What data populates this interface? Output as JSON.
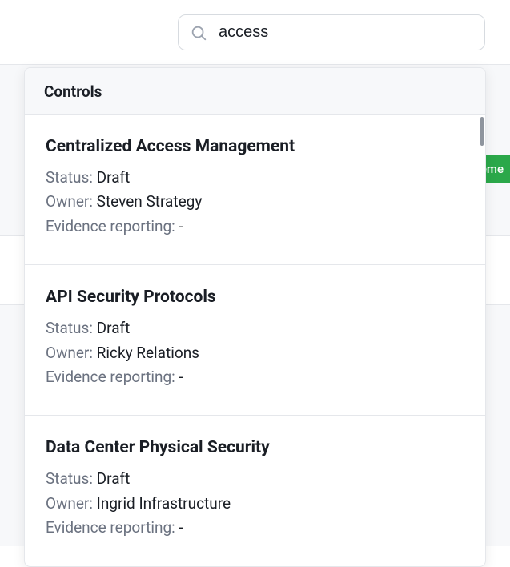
{
  "search": {
    "value": "access",
    "placeholder": "Search"
  },
  "badge_text": "eme",
  "dropdown": {
    "header": "Controls",
    "results": [
      {
        "title": "Centralized Access Management",
        "status_label": "Status: ",
        "status_value": "Draft",
        "owner_label": "Owner: ",
        "owner_value": "Steven Strategy",
        "evidence_label": "Evidence reporting: ",
        "evidence_value": " -"
      },
      {
        "title": "API Security Protocols",
        "status_label": "Status: ",
        "status_value": "Draft",
        "owner_label": "Owner: ",
        "owner_value": "Ricky Relations",
        "evidence_label": "Evidence reporting: ",
        "evidence_value": " -"
      },
      {
        "title": "Data Center Physical Security",
        "status_label": "Status: ",
        "status_value": "Draft",
        "owner_label": "Owner: ",
        "owner_value": "Ingrid Infrastructure",
        "evidence_label": "Evidence reporting: ",
        "evidence_value": " -"
      }
    ]
  }
}
